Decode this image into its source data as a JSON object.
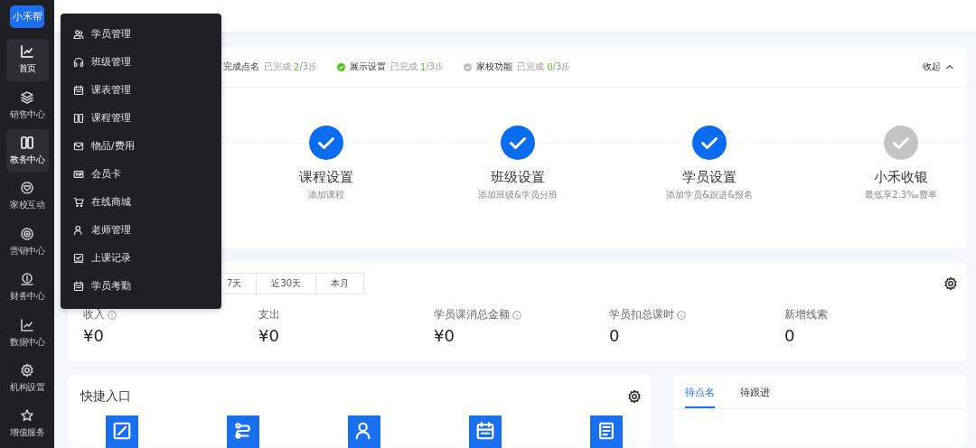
{
  "sidebar": {
    "logo_text": "小禾帮",
    "items": [
      {
        "label": "首页",
        "selected": true
      },
      {
        "label": "销售中心",
        "selected": false
      },
      {
        "label": "教务中心",
        "selected": true
      },
      {
        "label": "家校互动",
        "selected": false
      },
      {
        "label": "营销中心",
        "selected": false
      },
      {
        "label": "财务中心",
        "selected": false
      },
      {
        "label": "数据中心",
        "selected": false
      },
      {
        "label": "机构设置",
        "selected": false
      },
      {
        "label": "增值服务",
        "selected": false
      }
    ]
  },
  "dropdown": {
    "items": [
      {
        "label": "学员管理"
      },
      {
        "label": "班级管理"
      },
      {
        "label": "课表管理"
      },
      {
        "label": "课程管理"
      },
      {
        "label": "物品/费用"
      },
      {
        "label": "会员卡"
      },
      {
        "label": "在线商城"
      },
      {
        "label": "老师管理"
      },
      {
        "label": "上课记录"
      },
      {
        "label": "学员考勤"
      }
    ]
  },
  "setup": {
    "tasks": [
      {
        "title": "完成点名",
        "progress_label": "已完成",
        "progress_count": "2",
        "progress_rest": "/3步"
      },
      {
        "title": "展示设置",
        "done": true,
        "progress_label": "已完成",
        "progress_count": "1",
        "progress_rest": "/3步"
      },
      {
        "title": "家校功能",
        "done": false,
        "progress_label": "已完成",
        "progress_count": "0",
        "progress_rest": "/3步"
      }
    ],
    "collapse_label": "收起",
    "steps": [
      {
        "title": "课程设置",
        "subtitle": "添加课程",
        "done": true
      },
      {
        "title": "班级设置",
        "subtitle": "添加班级&学员分班",
        "done": true
      },
      {
        "title": "学员设置",
        "subtitle": "添加学员&跟进&报名",
        "done": true
      },
      {
        "title": "小禾收银",
        "subtitle": "最低享2.3‰费率",
        "done": false
      }
    ]
  },
  "stats": {
    "ranges": [
      {
        "label": "7天",
        "selected": false
      },
      {
        "label": "近30天",
        "selected": false
      },
      {
        "label": "本月",
        "selected": false
      }
    ],
    "metrics": [
      {
        "label": "收入",
        "info": true,
        "value": "¥0"
      },
      {
        "label": "支出",
        "info": false,
        "value": "¥0"
      },
      {
        "label": "学员课消总金额",
        "info": true,
        "value": "¥0"
      },
      {
        "label": "学员扣总课时",
        "info": true,
        "value": "0"
      },
      {
        "label": "新增线索",
        "info": false,
        "value": "0"
      }
    ]
  },
  "quick_entry": {
    "title": "快捷入口"
  },
  "todo": {
    "tabs": [
      {
        "label": "待点名",
        "selected": true
      },
      {
        "label": "待跟进",
        "selected": false
      }
    ]
  }
}
